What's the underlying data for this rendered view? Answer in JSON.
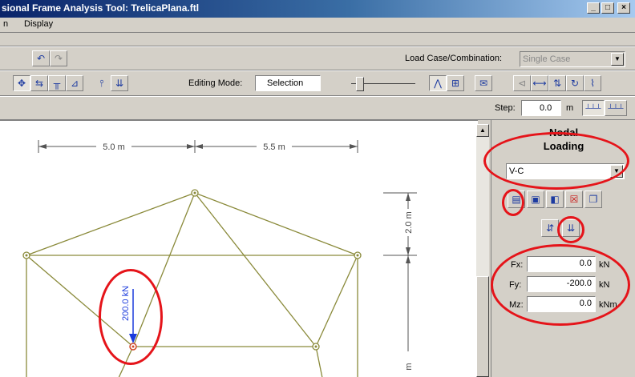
{
  "window": {
    "title": "sional Frame Analysis Tool: TrelicaPlana.ftl",
    "buttons": [
      "_",
      "□",
      "×"
    ]
  },
  "menu": [
    "n",
    "Display"
  ],
  "toolbar_top": {
    "load_case_label": "Load Case/Combination:",
    "load_case_value": "Single Case"
  },
  "toolbar_mode": {
    "editing_mode_label": "Editing Mode:",
    "editing_mode_value": "Selection"
  },
  "toolbar_step": {
    "step_label": "Step:",
    "step_value": "0.0",
    "step_unit": "m"
  },
  "drawing": {
    "dim_left": "5.0 m",
    "dim_right": "5.5 m",
    "dim_vertical": "2.0 m",
    "dim_vertical_2": "m",
    "load_label": "200.0 kN"
  },
  "panel": {
    "title_line1": "Nodal",
    "title_line2": "Loading",
    "case_value": "V-C",
    "fields": [
      {
        "label": "Fx:",
        "value": "0.0",
        "unit": "kN"
      },
      {
        "label": "Fy:",
        "value": "-200.0",
        "unit": "kN"
      },
      {
        "label": "Mz:",
        "value": "0.0",
        "unit": "kNm"
      }
    ]
  },
  "colors": {
    "title_gradient_start": "#0a246a",
    "structure_line": "#8a8a3a",
    "load_arrow": "#1a3adc",
    "highlight": "#e5141a"
  }
}
